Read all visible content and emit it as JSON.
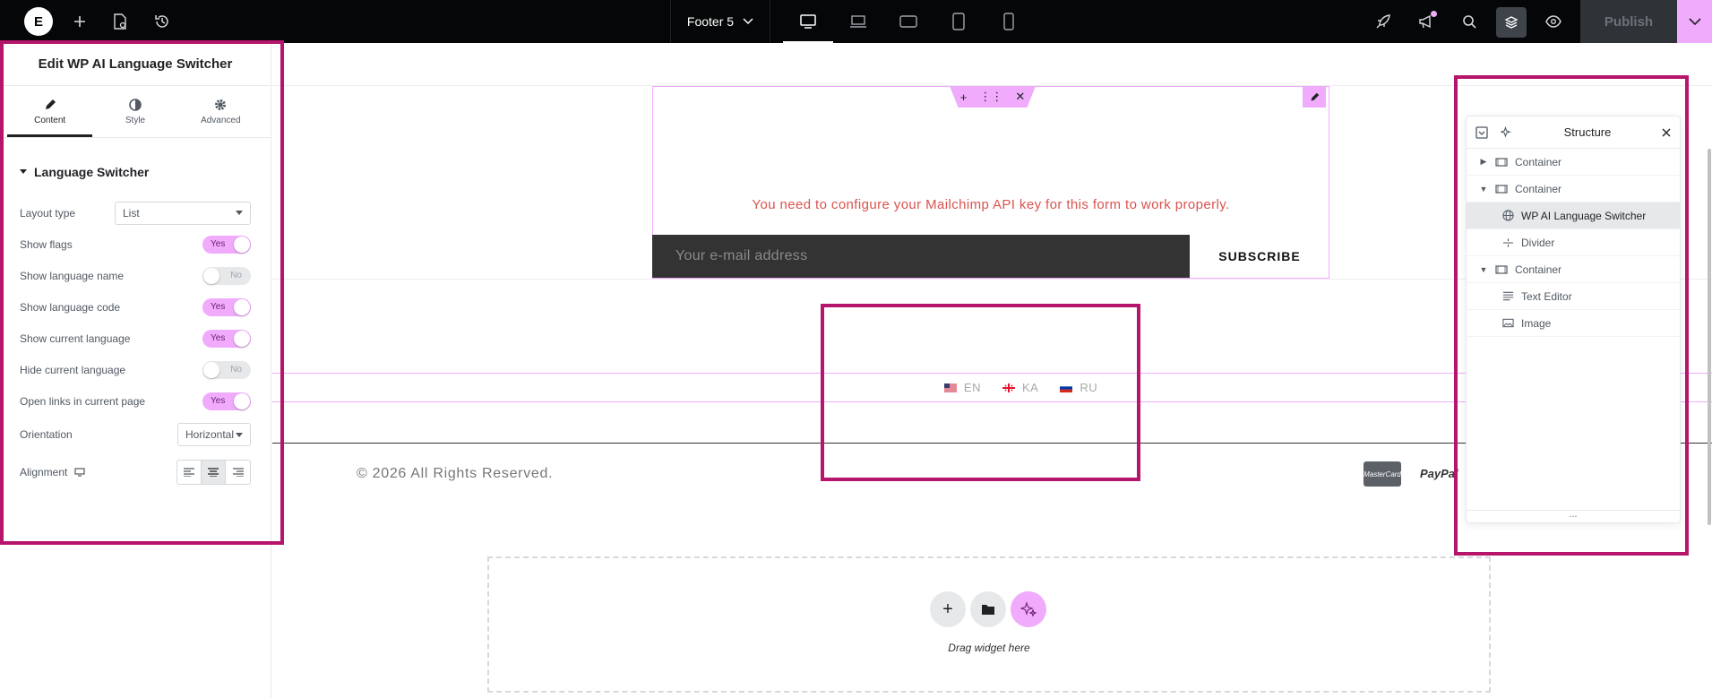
{
  "topbar": {
    "document_title": "Footer 5",
    "publish_label": "Publish"
  },
  "panel": {
    "title": "Edit WP AI Language Switcher",
    "tabs": [
      {
        "label": "Content",
        "icon": "pencil-icon"
      },
      {
        "label": "Style",
        "icon": "half-circle-icon"
      },
      {
        "label": "Advanced",
        "icon": "gear-icon"
      }
    ],
    "section": "Language Switcher",
    "controls": {
      "layout_type": {
        "label": "Layout type",
        "value": "List"
      },
      "show_flags": {
        "label": "Show flags",
        "state": "Yes"
      },
      "show_language_name": {
        "label": "Show language name",
        "state": "No"
      },
      "show_language_code": {
        "label": "Show language code",
        "state": "Yes"
      },
      "show_current_language": {
        "label": "Show current language",
        "state": "Yes"
      },
      "hide_current_language": {
        "label": "Hide current language",
        "state": "No"
      },
      "open_links": {
        "label": "Open links in current page",
        "state": "Yes"
      },
      "orientation": {
        "label": "Orientation",
        "value": "Horizontal"
      },
      "alignment": {
        "label": "Alignment",
        "selected": "center"
      }
    }
  },
  "canvas": {
    "mailchimp_warning": "You need to configure your Mailchimp API key for this form to work properly.",
    "email_placeholder": "Your e-mail address",
    "subscribe_label": "SUBSCRIBE",
    "languages": [
      {
        "code": "EN",
        "flag": "us-flag-icon"
      },
      {
        "code": "KA",
        "flag": "georgia-flag-icon"
      },
      {
        "code": "RU",
        "flag": "russia-flag-icon"
      }
    ],
    "copyright": "© 2026 All Rights Reserved.",
    "payment": {
      "mastercard": "MasterCard",
      "paypal": "PayPal"
    },
    "drag_text": "Drag widget here"
  },
  "structure": {
    "title": "Structure",
    "nodes": [
      {
        "label": "Container"
      },
      {
        "label": "Container"
      },
      {
        "label": "WP AI Language Switcher"
      },
      {
        "label": "Divider"
      },
      {
        "label": "Container"
      },
      {
        "label": "Text Editor"
      },
      {
        "label": "Image"
      }
    ]
  },
  "colors": {
    "accent": "#f0abfc",
    "highlight": "#b5156a",
    "topbar": "#050607",
    "warning": "#d9534f"
  }
}
